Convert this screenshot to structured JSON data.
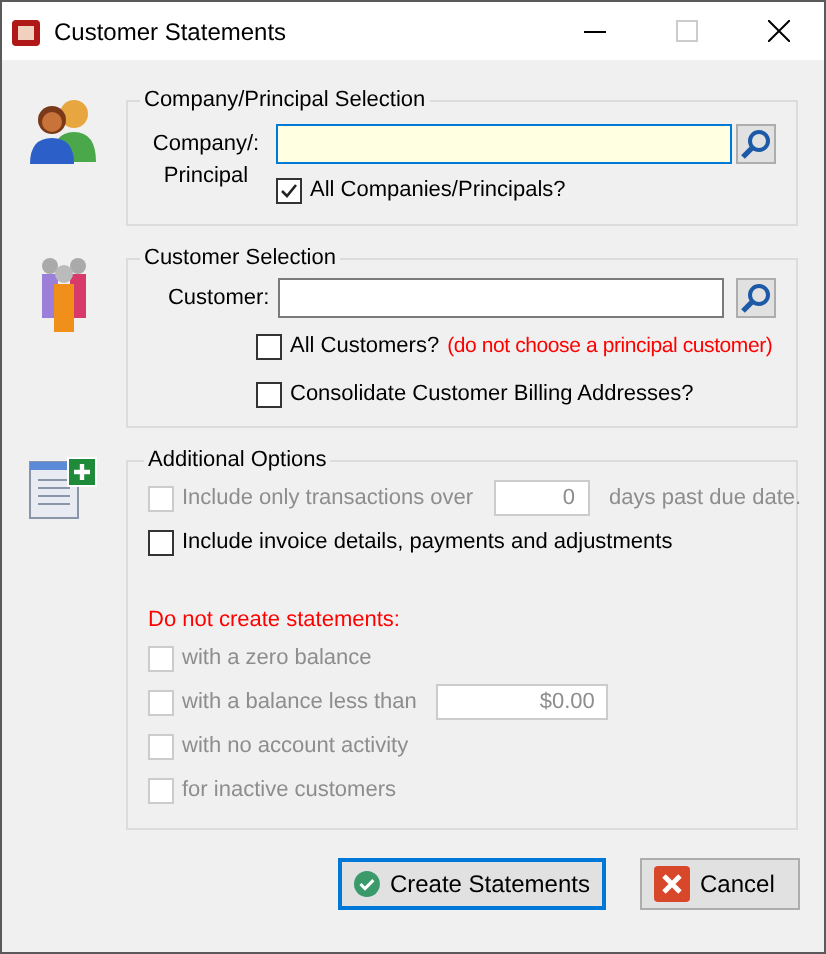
{
  "window": {
    "title": "Customer Statements",
    "maximize_disabled": true
  },
  "company_selection": {
    "legend": "Company/Principal Selection",
    "label": "Company/: Principal",
    "focused": true,
    "all_checkbox": {
      "label": "All Companies/Principals?",
      "checked": true
    }
  },
  "customer_selection": {
    "legend": "Customer Selection",
    "label": "Customer:",
    "focused": false,
    "checkboxes": [
      {
        "label": "All Customers?",
        "note": "(do not choose a principal customer)",
        "checked": false
      },
      {
        "label": "Consolidate Customer Billing Addresses?",
        "checked": false
      }
    ]
  },
  "additional_options": {
    "legend": "Additional Options",
    "options": [
      {
        "kind": "days",
        "label": "Include only transactions over",
        "value": "0",
        "suffix": "days past due date.",
        "checked": false,
        "disabled": true
      },
      {
        "kind": "plain",
        "label": "Include invoice details, payments and adjustments",
        "checked": false,
        "disabled": false
      }
    ],
    "exclusion_heading": "Do not create statements:",
    "exclusions": [
      {
        "kind": "plain",
        "label": "with a zero balance",
        "checked": false,
        "disabled": true
      },
      {
        "kind": "amount",
        "label": "with a balance less than",
        "value": "$0.00",
        "checked": false,
        "disabled": true
      },
      {
        "kind": "plain",
        "label": "with no account activity",
        "checked": false,
        "disabled": true
      },
      {
        "kind": "plain",
        "label": "for inactive customers",
        "checked": false,
        "disabled": true
      }
    ]
  },
  "buttons": [
    {
      "kind": "ok",
      "label": "Create Statements",
      "default": true
    },
    {
      "kind": "cancel",
      "label": "Cancel",
      "default": false
    }
  ]
}
